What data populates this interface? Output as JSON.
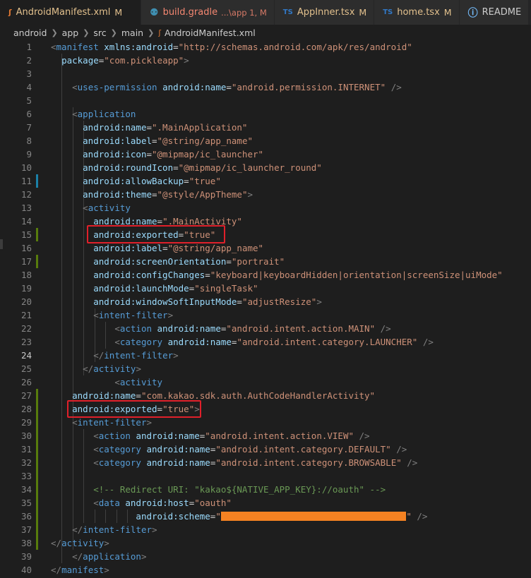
{
  "tabs": [
    {
      "icon": "rss-icon",
      "glyph": "ʃ",
      "name": "AndroidManifest.xml",
      "desc": "",
      "status": "M",
      "name_color": "#e2c08d",
      "status_color": "#e2c08d",
      "active": true
    },
    {
      "icon": "gradle-elephant-icon",
      "glyph": "⚉",
      "name": "build.gradle",
      "desc": "...\\app 1, M",
      "status": "",
      "name_color": "#f48771",
      "status_color": "#f48771",
      "active": false
    },
    {
      "icon": "typescript-icon",
      "glyph": "TS",
      "name": "AppInner.tsx",
      "desc": "",
      "status": "M",
      "name_color": "#e2c08d",
      "status_color": "#e2c08d",
      "active": false
    },
    {
      "icon": "typescript-icon",
      "glyph": "TS",
      "name": "home.tsx",
      "desc": "",
      "status": "M",
      "name_color": "#e2c08d",
      "status_color": "#e2c08d",
      "active": false
    },
    {
      "icon": "info-icon",
      "glyph": "ⓘ",
      "name": "README",
      "desc": "",
      "status": "",
      "name_color": "#cccccc",
      "status_color": "#cccccc",
      "active": false
    }
  ],
  "breadcrumb": [
    "android",
    "app",
    "src",
    "main",
    "AndroidManifest.xml"
  ],
  "colors": {
    "tag": "#569cd6",
    "attr": "#9cdcfe",
    "str": "#ce9178",
    "punct": "#808080",
    "text": "#d4d4d4",
    "comment": "#6a9955",
    "mod_bar_added": "#587c0c",
    "mod_bar_changed": "#1b81a8"
  },
  "current_line": 24,
  "lines": [
    [
      [
        "p",
        "<"
      ],
      [
        "t",
        "manifest"
      ],
      [
        "s",
        " "
      ],
      [
        "a",
        "xmlns:android"
      ],
      [
        "x",
        "="
      ],
      [
        "v",
        "\"http://schemas.android.com/apk/res/android\""
      ]
    ],
    [
      [
        "s",
        "  "
      ],
      [
        "a",
        "package"
      ],
      [
        "x",
        "="
      ],
      [
        "v",
        "\"com.pickleapp\""
      ],
      [
        "p",
        ">"
      ]
    ],
    [],
    [
      [
        "s",
        "    "
      ],
      [
        "p",
        "<"
      ],
      [
        "t",
        "uses-permission"
      ],
      [
        "s",
        " "
      ],
      [
        "a",
        "android:name"
      ],
      [
        "x",
        "="
      ],
      [
        "v",
        "\"android.permission.INTERNET\""
      ],
      [
        "s",
        " "
      ],
      [
        "p",
        "/>"
      ]
    ],
    [],
    [
      [
        "s",
        "    "
      ],
      [
        "p",
        "<"
      ],
      [
        "t",
        "application"
      ]
    ],
    [
      [
        "s",
        "      "
      ],
      [
        "a",
        "android:name"
      ],
      [
        "x",
        "="
      ],
      [
        "v",
        "\".MainApplication\""
      ]
    ],
    [
      [
        "s",
        "      "
      ],
      [
        "a",
        "android:label"
      ],
      [
        "x",
        "="
      ],
      [
        "v",
        "\"@string/app_name\""
      ]
    ],
    [
      [
        "s",
        "      "
      ],
      [
        "a",
        "android:icon"
      ],
      [
        "x",
        "="
      ],
      [
        "v",
        "\"@mipmap/ic_launcher\""
      ]
    ],
    [
      [
        "s",
        "      "
      ],
      [
        "a",
        "android:roundIcon"
      ],
      [
        "x",
        "="
      ],
      [
        "v",
        "\"@mipmap/ic_launcher_round\""
      ]
    ],
    [
      [
        "s",
        "      "
      ],
      [
        "a",
        "android:allowBackup"
      ],
      [
        "x",
        "="
      ],
      [
        "v",
        "\"true\""
      ]
    ],
    [
      [
        "s",
        "      "
      ],
      [
        "a",
        "android:theme"
      ],
      [
        "x",
        "="
      ],
      [
        "v",
        "\"@style/AppTheme\""
      ],
      [
        "p",
        ">"
      ]
    ],
    [
      [
        "s",
        "      "
      ],
      [
        "p",
        "<"
      ],
      [
        "t",
        "activity"
      ]
    ],
    [
      [
        "s",
        "        "
      ],
      [
        "a",
        "android:name"
      ],
      [
        "x",
        "="
      ],
      [
        "v",
        "\".MainActivity\""
      ]
    ],
    [
      [
        "s",
        "        "
      ],
      [
        "a",
        "android:exported"
      ],
      [
        "x",
        "="
      ],
      [
        "v",
        "\"true\""
      ]
    ],
    [
      [
        "s",
        "        "
      ],
      [
        "a",
        "android:label"
      ],
      [
        "x",
        "="
      ],
      [
        "v",
        "\"@string/app_name\""
      ]
    ],
    [
      [
        "s",
        "        "
      ],
      [
        "a",
        "android:screenOrientation"
      ],
      [
        "x",
        "="
      ],
      [
        "v",
        "\"portrait\""
      ]
    ],
    [
      [
        "s",
        "        "
      ],
      [
        "a",
        "android:configChanges"
      ],
      [
        "x",
        "="
      ],
      [
        "v",
        "\"keyboard|keyboardHidden|orientation|screenSize|uiMode\""
      ]
    ],
    [
      [
        "s",
        "        "
      ],
      [
        "a",
        "android:launchMode"
      ],
      [
        "x",
        "="
      ],
      [
        "v",
        "\"singleTask\""
      ]
    ],
    [
      [
        "s",
        "        "
      ],
      [
        "a",
        "android:windowSoftInputMode"
      ],
      [
        "x",
        "="
      ],
      [
        "v",
        "\"adjustResize\""
      ],
      [
        "p",
        ">"
      ]
    ],
    [
      [
        "s",
        "        "
      ],
      [
        "p",
        "<"
      ],
      [
        "t",
        "intent-filter"
      ],
      [
        "p",
        ">"
      ]
    ],
    [
      [
        "s",
        "            "
      ],
      [
        "p",
        "<"
      ],
      [
        "t",
        "action"
      ],
      [
        "s",
        " "
      ],
      [
        "a",
        "android:name"
      ],
      [
        "x",
        "="
      ],
      [
        "v",
        "\"android.intent.action.MAIN\""
      ],
      [
        "s",
        " "
      ],
      [
        "p",
        "/>"
      ]
    ],
    [
      [
        "s",
        "            "
      ],
      [
        "p",
        "<"
      ],
      [
        "t",
        "category"
      ],
      [
        "s",
        " "
      ],
      [
        "a",
        "android:name"
      ],
      [
        "x",
        "="
      ],
      [
        "v",
        "\"android.intent.category.LAUNCHER\""
      ],
      [
        "s",
        " "
      ],
      [
        "p",
        "/>"
      ]
    ],
    [
      [
        "s",
        "        "
      ],
      [
        "p",
        "</"
      ],
      [
        "t",
        "intent-filter"
      ],
      [
        "p",
        ">"
      ]
    ],
    [
      [
        "s",
        "      "
      ],
      [
        "p",
        "</"
      ],
      [
        "t",
        "activity"
      ],
      [
        "p",
        ">"
      ]
    ],
    [
      [
        "s",
        "            "
      ],
      [
        "p",
        "<"
      ],
      [
        "t",
        "activity"
      ]
    ],
    [
      [
        "s",
        "    "
      ],
      [
        "a",
        "android:name"
      ],
      [
        "x",
        "="
      ],
      [
        "v",
        "\"com.kakao.sdk.auth.AuthCodeHandlerActivity\""
      ]
    ],
    [
      [
        "s",
        "    "
      ],
      [
        "a",
        "android:exported"
      ],
      [
        "x",
        "="
      ],
      [
        "v",
        "\"true\""
      ],
      [
        "p",
        ">"
      ]
    ],
    [
      [
        "s",
        "    "
      ],
      [
        "p",
        "<"
      ],
      [
        "t",
        "intent-filter"
      ],
      [
        "p",
        ">"
      ]
    ],
    [
      [
        "s",
        "        "
      ],
      [
        "p",
        "<"
      ],
      [
        "t",
        "action"
      ],
      [
        "s",
        " "
      ],
      [
        "a",
        "android:name"
      ],
      [
        "x",
        "="
      ],
      [
        "v",
        "\"android.intent.action.VIEW\""
      ],
      [
        "s",
        " "
      ],
      [
        "p",
        "/>"
      ]
    ],
    [
      [
        "s",
        "        "
      ],
      [
        "p",
        "<"
      ],
      [
        "t",
        "category"
      ],
      [
        "s",
        " "
      ],
      [
        "a",
        "android:name"
      ],
      [
        "x",
        "="
      ],
      [
        "v",
        "\"android.intent.category.DEFAULT\""
      ],
      [
        "s",
        " "
      ],
      [
        "p",
        "/>"
      ]
    ],
    [
      [
        "s",
        "        "
      ],
      [
        "p",
        "<"
      ],
      [
        "t",
        "category"
      ],
      [
        "s",
        " "
      ],
      [
        "a",
        "android:name"
      ],
      [
        "x",
        "="
      ],
      [
        "v",
        "\"android.intent.category.BROWSABLE\""
      ],
      [
        "s",
        " "
      ],
      [
        "p",
        "/>"
      ]
    ],
    [],
    [
      [
        "s",
        "        "
      ],
      [
        "c",
        "<!-- Redirect URI: \"kakao${NATIVE_APP_KEY}://oauth\" -->"
      ]
    ],
    [
      [
        "s",
        "        "
      ],
      [
        "p",
        "<"
      ],
      [
        "t",
        "data"
      ],
      [
        "s",
        " "
      ],
      [
        "a",
        "android:host"
      ],
      [
        "x",
        "="
      ],
      [
        "v",
        "\"oauth\""
      ]
    ],
    [
      [
        "s",
        "                "
      ],
      [
        "a",
        "android:scheme"
      ],
      [
        "x",
        "="
      ],
      [
        "v",
        "\""
      ],
      [
        "R",
        "                                  "
      ],
      [
        "v",
        "\""
      ],
      [
        "s",
        " "
      ],
      [
        "p",
        "/>"
      ]
    ],
    [
      [
        "s",
        "    "
      ],
      [
        "p",
        "</"
      ],
      [
        "t",
        "intent-filter"
      ],
      [
        "p",
        ">"
      ]
    ],
    [
      [
        "p",
        "</"
      ],
      [
        "t",
        "activity"
      ],
      [
        "p",
        ">"
      ]
    ],
    [
      [
        "s",
        "    "
      ],
      [
        "p",
        "</"
      ],
      [
        "t",
        "application"
      ],
      [
        "p",
        ">"
      ]
    ],
    [
      [
        "p",
        "</"
      ],
      [
        "t",
        "manifest"
      ],
      [
        "p",
        ">"
      ]
    ]
  ],
  "mod_bars": [
    {
      "line": 11,
      "kind": "changed"
    },
    {
      "line": 15,
      "kind": "added"
    },
    {
      "line": 17,
      "kind": "added"
    },
    {
      "line": 27,
      "kind": "added"
    },
    {
      "line": 28,
      "kind": "added"
    },
    {
      "line": 29,
      "kind": "added"
    },
    {
      "line": 30,
      "kind": "added"
    },
    {
      "line": 31,
      "kind": "added"
    },
    {
      "line": 32,
      "kind": "added"
    },
    {
      "line": 33,
      "kind": "added"
    },
    {
      "line": 34,
      "kind": "added"
    },
    {
      "line": 35,
      "kind": "added"
    },
    {
      "line": 36,
      "kind": "added"
    },
    {
      "line": 37,
      "kind": "added"
    },
    {
      "line": 38,
      "kind": "added"
    }
  ]
}
